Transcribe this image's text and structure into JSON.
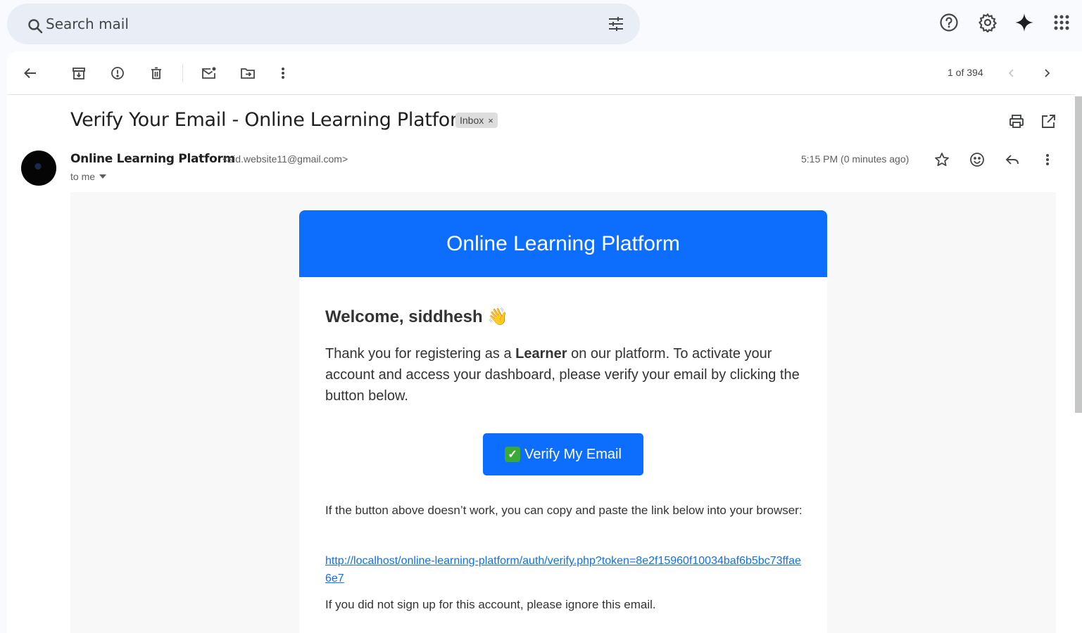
{
  "search": {
    "placeholder": "Search mail"
  },
  "toolbar": {
    "pager": "1 of 394"
  },
  "email": {
    "subject": "Verify Your Email - Online Learning Platform",
    "label": "Inbox",
    "label_remove": "×",
    "sender_name": "Online Learning Platform",
    "sender_email": "<sid.website11@gmail.com>",
    "to": "to me",
    "time": "5:15 PM (0 minutes ago)"
  },
  "body": {
    "header": "Online Learning Platform",
    "welcome": "Welcome, siddhesh 👋",
    "para_before": "Thank you for registering as a ",
    "para_bold": "Learner",
    "para_after": " on our platform. To activate your account and access your dashboard, please verify your email by clicking the button below.",
    "button_check": "✓",
    "button_label": "Verify My Email",
    "fallback": "If the button above doesn’t work, you can copy and paste the link below into your browser:",
    "link": "http://localhost/online-learning-platform/auth/verify.php?token=8e2f15960f10034baf6b5bc73ffae6e7",
    "ignore": "If you did not sign up for this account, please ignore this email."
  },
  "colors": {
    "accent": "#0d6efd",
    "search_bg": "#e9eef6",
    "page_bg": "#f8fafd"
  },
  "icons": [
    "search-icon",
    "tune-icon",
    "help-icon",
    "gear-icon",
    "sparkle-icon",
    "apps-icon",
    "back-arrow-icon",
    "archive-icon",
    "report-spam-icon",
    "delete-icon",
    "mark-unread-icon",
    "move-to-icon",
    "more-vert-icon",
    "chevron-left-icon",
    "chevron-right-icon",
    "print-icon",
    "open-new-window-icon",
    "star-icon",
    "emoji-icon",
    "reply-icon"
  ]
}
